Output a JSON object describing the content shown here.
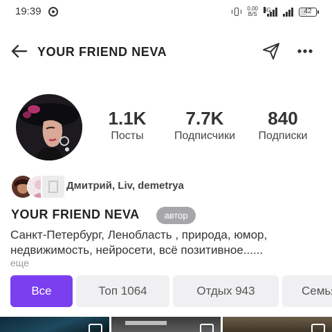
{
  "status_bar": {
    "time": "19:39",
    "net_speed_value": "0,00",
    "net_speed_unit": "B/S",
    "network": "4G",
    "battery": "42",
    "battery_level": 0.42
  },
  "header": {
    "title": "YOUR FRIEND NEVA",
    "icons": [
      "back-arrow-icon",
      "share-icon",
      "more-icon"
    ]
  },
  "stats": [
    {
      "value": "1.1K",
      "label": "Посты"
    },
    {
      "value": "7.7K",
      "label": "Подписчики"
    },
    {
      "value": "840",
      "label": "Подписки"
    }
  ],
  "mutual_followers": {
    "text": "Дмитрий, Liv, demetrya"
  },
  "profile": {
    "name": "YOUR FRIEND NEVA",
    "badge": "автор",
    "bio_line1": "Санкт-Петербург, Ленобласть , природа, юмор,",
    "bio_line2": "недвижимость, нейросети, всё позитивное......",
    "more": "еще"
  },
  "filter_chips": [
    {
      "label": "Все",
      "active": true
    },
    {
      "label": "Топ 1064",
      "active": false
    },
    {
      "label": "Отдых 943",
      "active": false
    },
    {
      "label": "Семья",
      "active": false
    }
  ],
  "colors": {
    "accent": "#7b3ff0",
    "chip_background": "#f0f0f3",
    "badge_background": "#a7a7ab"
  }
}
